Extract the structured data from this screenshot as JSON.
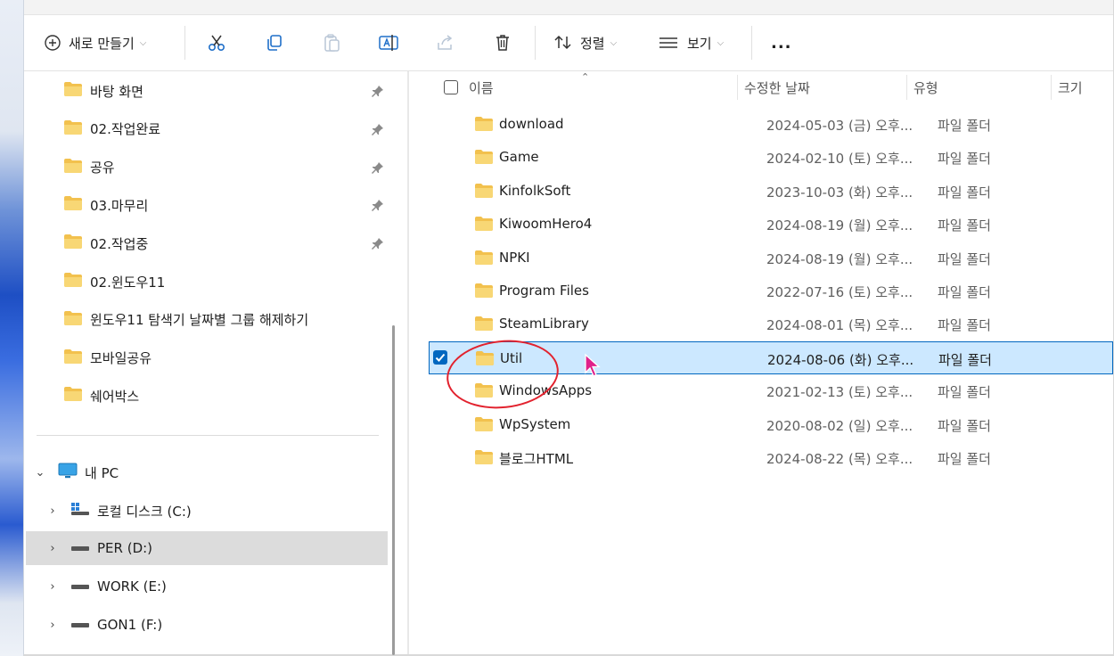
{
  "toolbar": {
    "new_label": "새로 만들기",
    "sort_label": "정렬",
    "view_label": "보기",
    "more_label": "..."
  },
  "quick_access": [
    {
      "label": "바탕 화면",
      "pinned": true
    },
    {
      "label": "02.작업완료",
      "pinned": true
    },
    {
      "label": "공유",
      "pinned": true
    },
    {
      "label": "03.마무리",
      "pinned": true
    },
    {
      "label": "02.작업중",
      "pinned": true
    },
    {
      "label": "02.윈도우11",
      "pinned": false
    },
    {
      "label": "윈도우11 탐색기 날짜별 그룹 해제하기",
      "pinned": false
    },
    {
      "label": "모바일공유",
      "pinned": false
    },
    {
      "label": "쉐어박스",
      "pinned": false
    }
  ],
  "tree": {
    "pc_label": "내 PC",
    "drives": [
      {
        "label": "로컬 디스크 (C:)"
      },
      {
        "label": "PER (D:)",
        "selected": true
      },
      {
        "label": "WORK (E:)"
      },
      {
        "label": "GON1 (F:)"
      }
    ]
  },
  "columns": {
    "name": "이름",
    "date": "수정한 날짜",
    "type": "유형",
    "size": "크기"
  },
  "files": [
    {
      "name": "download",
      "date": "2024-05-03 (금) 오후...",
      "type": "파일 폴더"
    },
    {
      "name": "Game",
      "date": "2024-02-10 (토) 오후...",
      "type": "파일 폴더"
    },
    {
      "name": "KinfolkSoft",
      "date": "2023-10-03 (화) 오후...",
      "type": "파일 폴더"
    },
    {
      "name": "KiwoomHero4",
      "date": "2024-08-19 (월) 오후...",
      "type": "파일 폴더"
    },
    {
      "name": "NPKI",
      "date": "2024-08-19 (월) 오후...",
      "type": "파일 폴더"
    },
    {
      "name": "Program Files",
      "date": "2022-07-16 (토) 오후...",
      "type": "파일 폴더"
    },
    {
      "name": "SteamLibrary",
      "date": "2024-08-01 (목) 오후...",
      "type": "파일 폴더"
    },
    {
      "name": "Util",
      "date": "2024-08-06 (화) 오후...",
      "type": "파일 폴더",
      "selected": true
    },
    {
      "name": "WindowsApps",
      "date": "2021-02-13 (토) 오후...",
      "type": "파일 폴더"
    },
    {
      "name": "WpSystem",
      "date": "2020-08-02 (일) 오후...",
      "type": "파일 폴더"
    },
    {
      "name": "블로그HTML",
      "date": "2024-08-22 (목) 오후...",
      "type": "파일 폴더"
    }
  ],
  "colors": {
    "selection_fill": "#cce8ff",
    "selection_border": "#0067c0",
    "folder": "#f2c14e",
    "annotation": "#e2222e",
    "cursor": "#e0218a"
  }
}
